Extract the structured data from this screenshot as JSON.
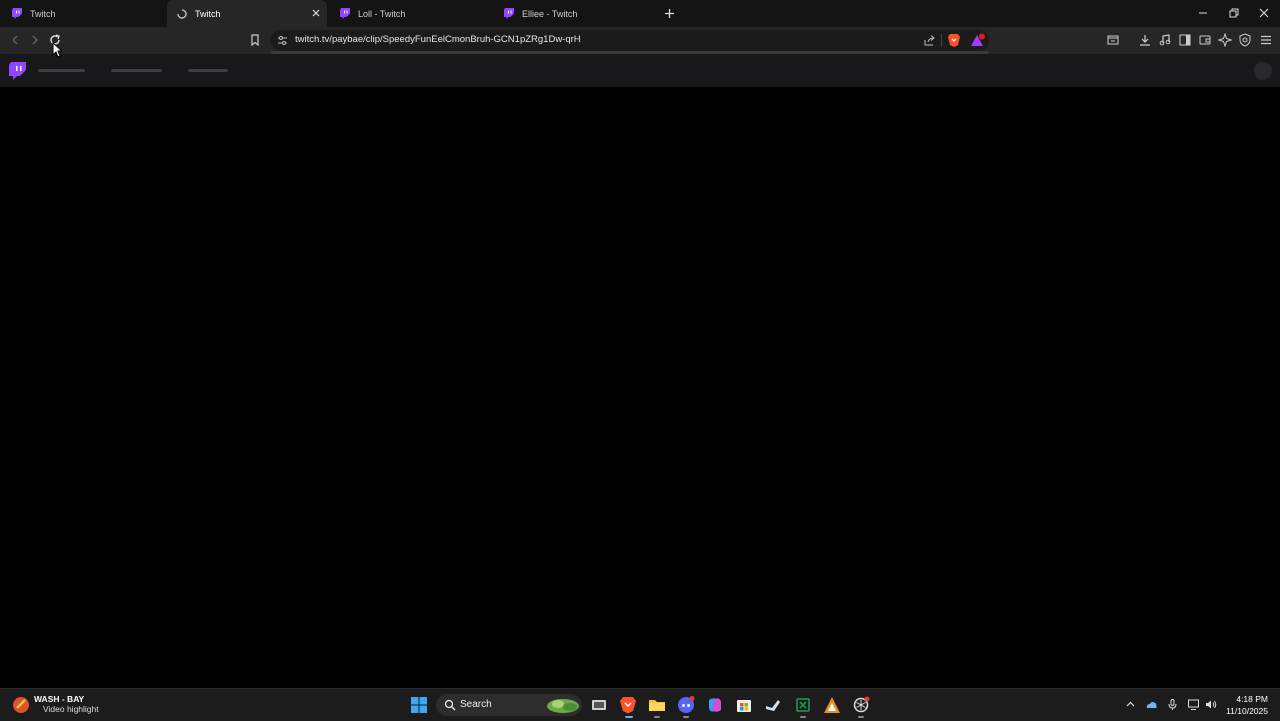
{
  "tabs": [
    {
      "label": "Twitch",
      "active": false
    },
    {
      "label": "Twitch",
      "active": true
    },
    {
      "label": "Loll - Twitch",
      "active": false
    },
    {
      "label": "Elliee - Twitch",
      "active": false
    }
  ],
  "address": {
    "url": "twitch.tv/paybae/clip/SpeedyFunEelCmonBruh-GCN1pZRg1Dw-qrH"
  },
  "notification": {
    "title": "WASH - BAY",
    "subtitle": "Video highlight"
  },
  "taskbar": {
    "search_label": "Search"
  },
  "clock": {
    "time": "4:18 PM",
    "date": "11/10/2025"
  },
  "colors": {
    "twitch_purple": "#9146ff",
    "brave_orange": "#fb542b",
    "page_background": "#000000"
  }
}
